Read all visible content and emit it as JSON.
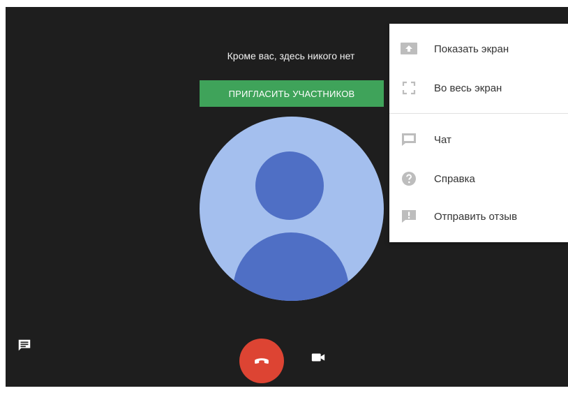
{
  "call": {
    "empty_message": "Кроме вас, здесь никого нет",
    "invite_label": "ПРИГЛАСИТЬ УЧАСТНИКОВ"
  },
  "controls": {
    "chat_icon": "chat-icon",
    "hangup_icon": "hangup-icon",
    "camera_icon": "camera-icon"
  },
  "menu": {
    "items": [
      {
        "label": "Показать экран",
        "icon": "present-screen-icon"
      },
      {
        "label": "Во весь экран",
        "icon": "fullscreen-icon"
      },
      {
        "label": "Чат",
        "icon": "chat-icon"
      },
      {
        "label": "Справка",
        "icon": "help-icon"
      },
      {
        "label": "Отправить отзыв",
        "icon": "feedback-icon"
      }
    ]
  },
  "colors": {
    "background": "#1e1e1e",
    "invite_button": "#3fa35a",
    "avatar_light": "#a4bfee",
    "avatar_dark": "#4f6fc5",
    "hangup": "#dd4433",
    "menu_icon": "#bdbdbd"
  }
}
